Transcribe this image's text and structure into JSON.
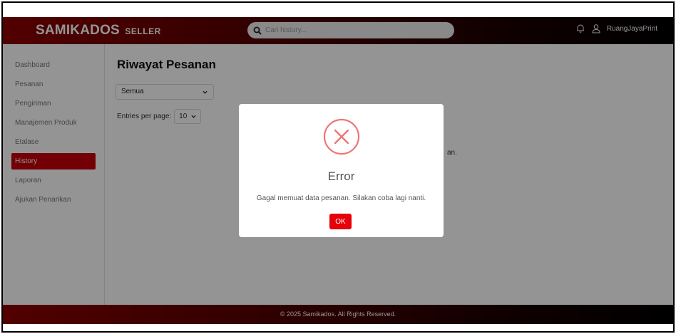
{
  "header": {
    "brand": "SAMIKADOS",
    "brand_suffix": "SELLER",
    "search_placeholder": "Cari history...",
    "username": "RuangJayaPrint",
    "icons": [
      "bell-icon",
      "user-icon",
      "search-icon"
    ]
  },
  "sidebar": {
    "items": [
      {
        "label": "Dashboard",
        "active": false
      },
      {
        "label": "Pesanan",
        "active": false
      },
      {
        "label": "Pengiriman",
        "active": false
      },
      {
        "label": "Manajemen Produk",
        "active": false
      },
      {
        "label": "Etalase",
        "active": false
      },
      {
        "label": "History",
        "active": true
      },
      {
        "label": "Laporan",
        "active": false
      },
      {
        "label": "Ajukan Penarikan",
        "active": false
      }
    ]
  },
  "main": {
    "title": "Riwayat Pesanan",
    "filter_value": "Semua",
    "entries_label": "Entries per page:",
    "entries_value": "10",
    "partial_text": "an."
  },
  "footer": {
    "text": "© 2025 Samikados. All Rights Reserved."
  },
  "modal": {
    "title": "Error",
    "message": "Gagal memuat data pesanan. Silakan coba lagi nanti.",
    "ok_label": "OK"
  },
  "colors": {
    "accent": "#c4000a",
    "ok_button": "#e5000a",
    "error_icon": "#f27474"
  }
}
